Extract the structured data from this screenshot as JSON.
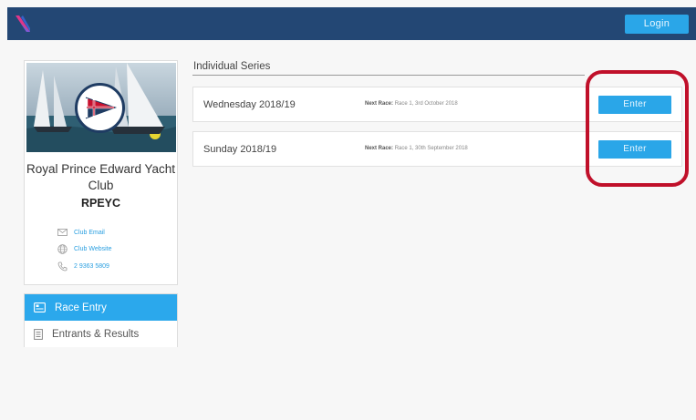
{
  "header": {
    "login_label": "Login"
  },
  "club": {
    "name": "Royal Prince Edward Yacht Club",
    "abbreviation": "RPEYC",
    "email_label": "Club Email",
    "website_label": "Club Website",
    "phone": "2 9363 5809"
  },
  "nav": {
    "items": [
      {
        "label": "Race Entry",
        "active": true
      },
      {
        "label": "Entrants & Results",
        "active": false
      }
    ]
  },
  "main": {
    "section_title": "Individual Series",
    "next_race_prefix": "Next Race:",
    "series": [
      {
        "name": "Wednesday 2018/19",
        "next_race": "Race 1, 3rd October 2018",
        "button": "Enter"
      },
      {
        "name": "Sunday 2018/19",
        "next_race": "Race 1, 30th September 2018",
        "button": "Enter"
      }
    ]
  },
  "colors": {
    "topbar": "#234774",
    "accent": "#2aa6e8",
    "highlight": "#c0102a"
  }
}
